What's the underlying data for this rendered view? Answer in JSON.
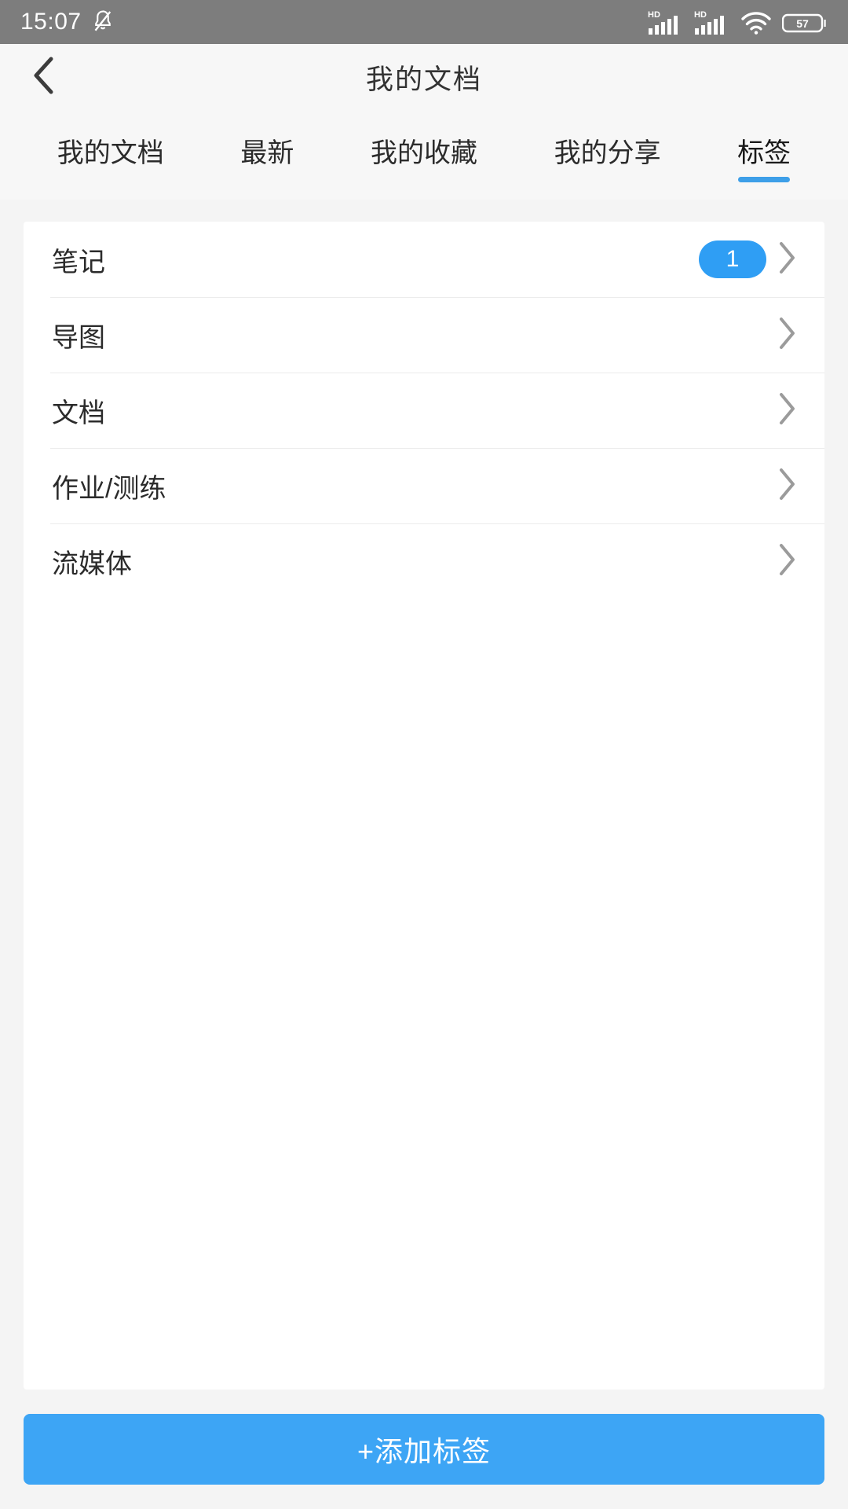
{
  "statusbar": {
    "time": "15:07",
    "mute_icon": "bell-muted-icon",
    "signal1_icon": "signal-hd-icon",
    "signal2_icon": "signal-hd-icon",
    "wifi_icon": "wifi-icon",
    "battery_icon": "battery-icon",
    "battery_level": "57",
    "bg_color": "#7d7d7d"
  },
  "header": {
    "back_icon": "chevron-left-icon",
    "title": "我的文档"
  },
  "tabs": {
    "active_index": 4,
    "accent_color": "#3d9fe8",
    "items": [
      {
        "label": "我的文档"
      },
      {
        "label": "最新"
      },
      {
        "label": "我的收藏"
      },
      {
        "label": "我的分享"
      },
      {
        "label": "标签"
      }
    ]
  },
  "list": {
    "chevron_icon": "chevron-right-icon",
    "badge_color": "#2f9ef4",
    "rows": [
      {
        "label": "笔记",
        "badge": "1"
      },
      {
        "label": "导图",
        "badge": ""
      },
      {
        "label": "文档",
        "badge": ""
      },
      {
        "label": "作业/测练",
        "badge": ""
      },
      {
        "label": "流媒体",
        "badge": ""
      }
    ]
  },
  "bottom": {
    "add_label": "+添加标签",
    "button_color": "#3da5f5"
  }
}
